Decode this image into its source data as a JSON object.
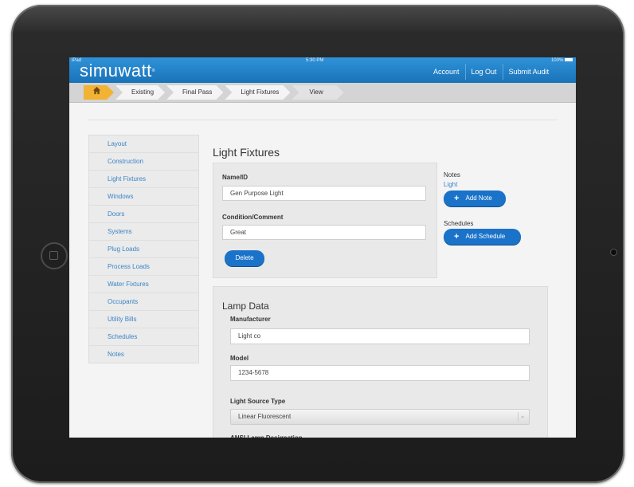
{
  "status_bar": {
    "carrier": "iPad",
    "time": "5:30 PM",
    "battery": "100%"
  },
  "app": {
    "logo": "simuwatt",
    "logo_mark": "®"
  },
  "header_nav": [
    "Account",
    "Log Out",
    "Submit Audit"
  ],
  "breadcrumbs": [
    "Existing",
    "Final Pass",
    "Light Fixtures",
    "View"
  ],
  "sidebar": {
    "items": [
      "Layout",
      "Construction",
      "Light Fixtures",
      "Windows",
      "Doors",
      "Systems",
      "Plug Loads",
      "Process Loads",
      "Water Fixtures",
      "Occupants",
      "Utility Bills",
      "Schedules",
      "Notes"
    ]
  },
  "main": {
    "title": "Light Fixtures",
    "name_label": "Name/ID",
    "name_value": "Gen Purpose Light",
    "condition_label": "Condition/Comment",
    "condition_value": "Great",
    "delete_label": "Delete",
    "notes_label": "Notes",
    "notes_link": "Light",
    "add_note_label": "Add Note",
    "schedules_label": "Schedules",
    "add_schedule_label": "Add Schedule"
  },
  "lamp": {
    "title": "Lamp Data",
    "manufacturer_label": "Manufacturer",
    "manufacturer_value": "Light co",
    "model_label": "Model",
    "model_value": "1234-5678",
    "source_label": "Light Source Type",
    "source_value": "Linear Fluorescent",
    "next_label": "ANSI Lamp Designation"
  },
  "colors": {
    "header": "#1f7ec6",
    "accent": "#1a73c9",
    "home_crumb": "#f2b233",
    "link": "#3b84c4"
  }
}
